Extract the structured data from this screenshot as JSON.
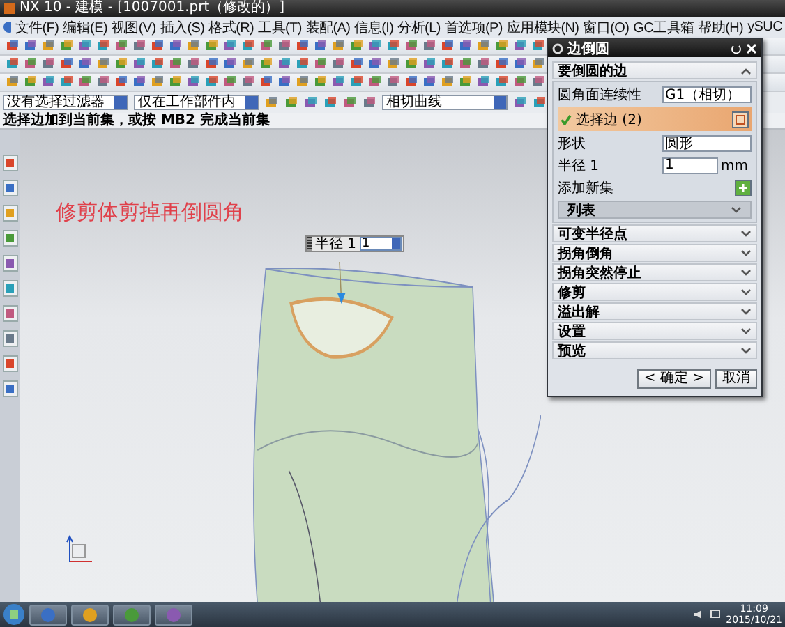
{
  "window": {
    "title": "NX 10 - 建模 - [1007001.prt（修改的）]"
  },
  "menu": [
    "文件(F)",
    "编辑(E)",
    "视图(V)",
    "插入(S)",
    "格式(R)",
    "工具(T)",
    "装配(A)",
    "信息(I)",
    "分析(L)",
    "首选项(P)",
    "应用模块(N)",
    "窗口(O)",
    "GC工具箱",
    "帮助(H)",
    "ySUC"
  ],
  "filter_bar": {
    "selection_filter": "没有选择过滤器",
    "scope": "仅在工作部件内",
    "curve_rule": "相切曲线"
  },
  "prompt": "选择边加到当前集，或按 MB2 完成当前集",
  "viewport": {
    "annotation": "修剪体剪掉再倒圆角",
    "radius_label": {
      "label": "半径 1",
      "value": "1"
    }
  },
  "dialog": {
    "title": "边倒圆",
    "section": {
      "title": "要倒圆的边",
      "expanded": true
    },
    "continuity": {
      "label": "圆角面连续性",
      "value": "G1（相切）"
    },
    "select_edge": {
      "label": "选择边 (2)",
      "checked": true
    },
    "shape": {
      "label": "形状",
      "value": "圆形"
    },
    "radius": {
      "label": "半径 1",
      "value": "1",
      "unit": "mm"
    },
    "add_set": "添加新集",
    "list": {
      "title": "列表",
      "expanded": false
    },
    "sections": [
      {
        "title": "可变半径点",
        "expanded": false
      },
      {
        "title": "拐角倒角",
        "expanded": false
      },
      {
        "title": "拐角突然停止",
        "expanded": false
      },
      {
        "title": "修剪",
        "expanded": false
      },
      {
        "title": "溢出解",
        "expanded": false
      },
      {
        "title": "设置",
        "expanded": false
      },
      {
        "title": "预览",
        "expanded": false
      }
    ],
    "buttons": [
      "< 确定 >",
      "取消"
    ]
  },
  "taskbar": {
    "time": "11:09",
    "date": "2015/10/21"
  }
}
